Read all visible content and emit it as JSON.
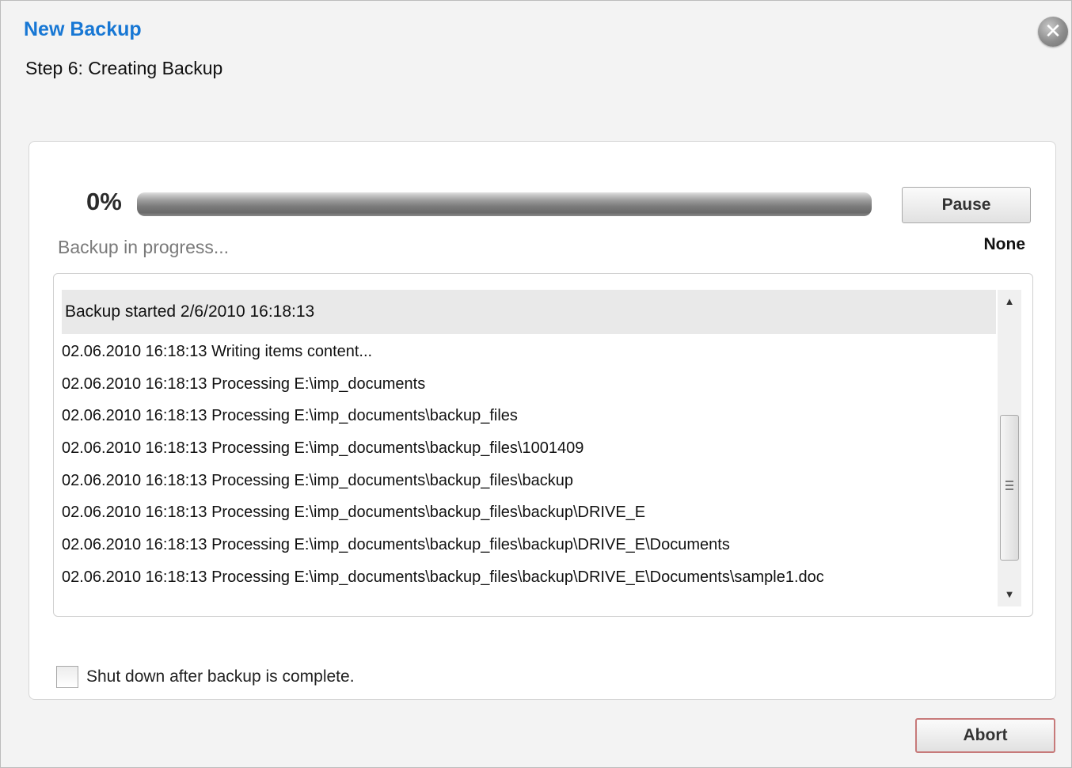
{
  "header": {
    "title": "New Backup",
    "step": "Step 6: Creating Backup",
    "close_icon": "close-icon"
  },
  "progress": {
    "percent_text": "0%",
    "value": 0,
    "status": "Backup in progress...",
    "speed": "None"
  },
  "buttons": {
    "pause": "Pause",
    "abort": "Abort"
  },
  "log": {
    "header": "Backup started 2/6/2010 16:18:13",
    "lines": [
      "02.06.2010 16:18:13 Writing items content...",
      "02.06.2010 16:18:13 Processing E:\\imp_documents",
      "02.06.2010 16:18:13 Processing E:\\imp_documents\\backup_files",
      "02.06.2010 16:18:13 Processing E:\\imp_documents\\backup_files\\1001409",
      "02.06.2010 16:18:13 Processing E:\\imp_documents\\backup_files\\backup",
      "02.06.2010 16:18:13 Processing E:\\imp_documents\\backup_files\\backup\\DRIVE_E",
      "02.06.2010 16:18:13 Processing E:\\imp_documents\\backup_files\\backup\\DRIVE_E\\Documents",
      "02.06.2010 16:18:13 Processing E:\\imp_documents\\backup_files\\backup\\DRIVE_E\\Documents\\sample1.doc"
    ]
  },
  "options": {
    "shutdown_label": "Shut down after backup is complete.",
    "shutdown_checked": false
  }
}
